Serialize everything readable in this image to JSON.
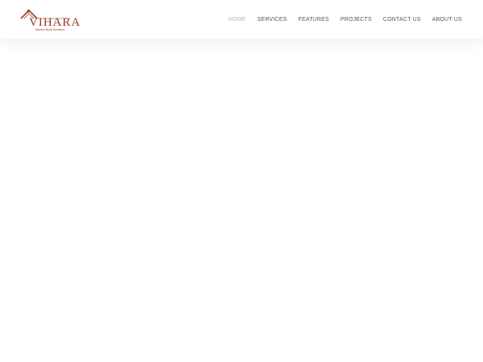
{
  "brand": {
    "name": "VIHARA",
    "tagline": "Weaver Build Solutions",
    "accent_color": "#9b3a2c",
    "logo_icon": "house-roof-icon"
  },
  "nav": {
    "items": [
      {
        "label": "HOME",
        "active": true
      },
      {
        "label": "SERVICES",
        "active": false
      },
      {
        "label": "FEATURES",
        "active": false
      },
      {
        "label": "PROJECTS",
        "active": false
      },
      {
        "label": "CONTACT US",
        "active": false
      },
      {
        "label": "ABOUT US",
        "active": false
      }
    ]
  }
}
